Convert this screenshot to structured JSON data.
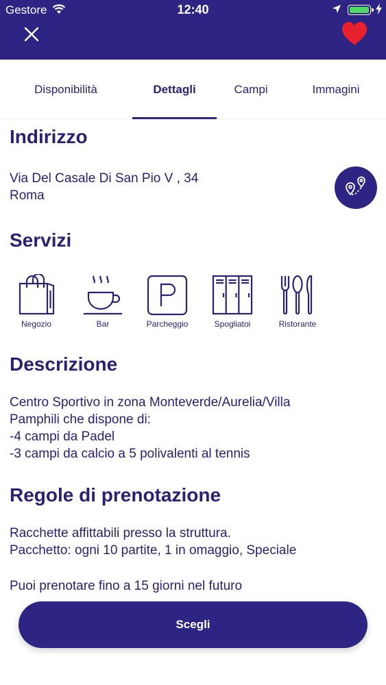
{
  "status_bar": {
    "carrier": "Gestore",
    "time": "12:40"
  },
  "header": {
    "close_icon": "close-icon",
    "favorite_icon": "heart-icon"
  },
  "tabs": [
    {
      "label": "Disponibilità",
      "active": false
    },
    {
      "label": "Dettagli",
      "active": true
    },
    {
      "label": "Campi",
      "active": false
    },
    {
      "label": "Immagini",
      "active": false
    }
  ],
  "address": {
    "title": "Indirizzo",
    "line1": "Via Del Casale Di San Pio V , 34",
    "line2": "Roma"
  },
  "services": {
    "title": "Servizi",
    "items": [
      {
        "label": "Negozio",
        "icon": "shop-bag-icon"
      },
      {
        "label": "Bar",
        "icon": "coffee-cup-icon"
      },
      {
        "label": "Parcheggio",
        "icon": "parking-icon"
      },
      {
        "label": "Spogliatoi",
        "icon": "lockers-icon"
      },
      {
        "label": "Ristorante",
        "icon": "cutlery-icon"
      }
    ]
  },
  "description": {
    "title": "Descrizione",
    "text": "Centro Sportivo in zona Monteverde/Aurelia/Villa\nPamphili che dispone di:\n-4 campi da Padel\n-3 campi da calcio a 5 polivalenti al tennis"
  },
  "rules": {
    "title": "Regole di prenotazione",
    "text": "Racchette affittabili presso la struttura.\nPacchetto: ogni 10 partite, 1 in omaggio, Speciale",
    "booking_window": "Puoi prenotare fino a 15 giorni nel futuro"
  },
  "cta": {
    "label": "Scegli"
  },
  "colors": {
    "primary": "#2e2483",
    "heart": "#e8202e",
    "battery": "#4cd964"
  }
}
